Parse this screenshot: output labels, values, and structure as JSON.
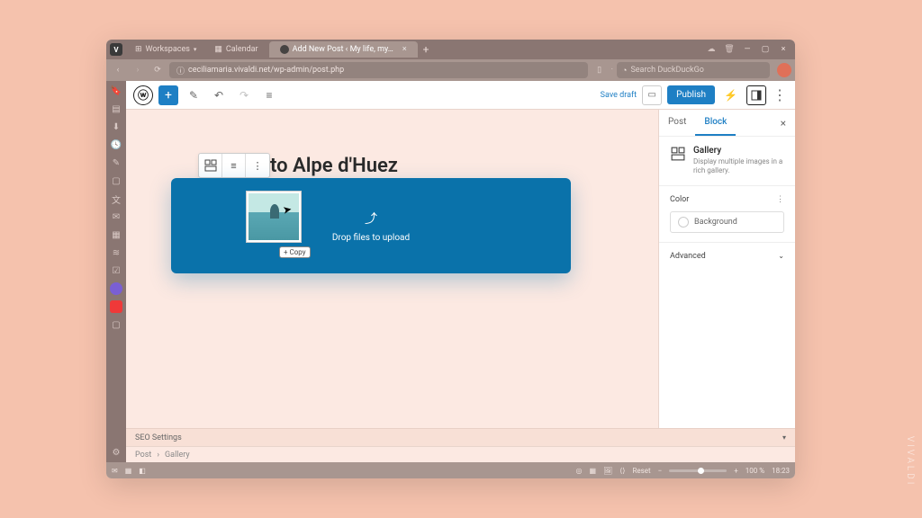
{
  "browser": {
    "workspaces_label": "Workspaces",
    "tabs": [
      {
        "label": "Calendar"
      },
      {
        "label": "Add New Post ‹ My life, my…"
      }
    ],
    "url": "ceciliamaria.vivaldi.net/wp-admin/post.php",
    "search_placeholder": "Search DuckDuckGo"
  },
  "wp_toolbar": {
    "save_draft": "Save draft",
    "publish": "Publish"
  },
  "editor": {
    "title": "to Alpe d'Huez",
    "dropzone_text": "Drop files to upload",
    "copy_badge": "+ Copy",
    "seo_settings": "SEO Settings",
    "breadcrumb_post": "Post",
    "breadcrumb_gallery": "Gallery"
  },
  "sidebar": {
    "tab_post": "Post",
    "tab_block": "Block",
    "block_name": "Gallery",
    "block_desc": "Display multiple images in a rich gallery.",
    "panel_color": "Color",
    "background_label": "Background",
    "panel_advanced": "Advanced"
  },
  "statusbar": {
    "reset": "Reset",
    "zoom": "100 %",
    "time": "18:23"
  },
  "watermark": "VIVALDI"
}
